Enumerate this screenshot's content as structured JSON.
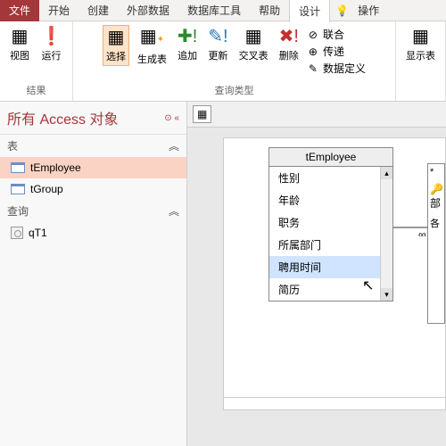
{
  "menu": {
    "file": "文件",
    "tabs": [
      "开始",
      "创建",
      "外部数据",
      "数据库工具",
      "帮助",
      "设计"
    ],
    "tell": "操作"
  },
  "ribbon": {
    "g1": {
      "view": "视图",
      "run": "运行",
      "cap": "结果"
    },
    "g2": {
      "select": "选择",
      "make": "生成表",
      "append": "追加",
      "update": "更新",
      "cross": "交叉表",
      "delete": "删除",
      "cap": "查询类型",
      "union": "联合",
      "pass": "传递",
      "ddl": "数据定义"
    },
    "g3": {
      "show": "显示表"
    }
  },
  "nav": {
    "title": "所有 Access 对象",
    "groups": {
      "tables": "表",
      "queries": "查询"
    },
    "tables": [
      "tEmployee",
      "tGroup"
    ],
    "queries": [
      "qT1"
    ]
  },
  "design": {
    "table1": {
      "name": "tEmployee",
      "fields": [
        "性别",
        "年龄",
        "职务",
        "所属部门",
        "聘用时间",
        "简历"
      ]
    },
    "table2": {
      "star": "*",
      "f1": "部",
      "f2": "各"
    }
  }
}
